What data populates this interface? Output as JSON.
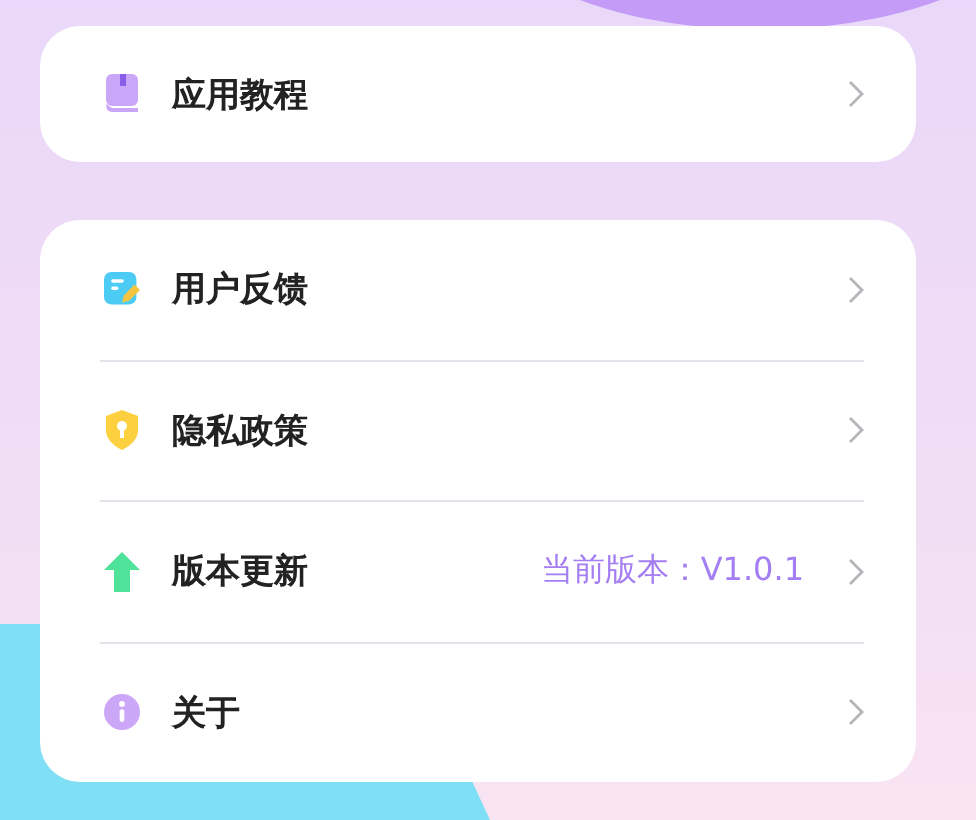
{
  "groups": [
    {
      "items": [
        {
          "kind": "book",
          "label": "应用教程"
        }
      ]
    },
    {
      "items": [
        {
          "kind": "note",
          "label": "用户反馈"
        },
        {
          "kind": "shield",
          "label": "隐私政策"
        },
        {
          "kind": "upload",
          "label": "版本更新",
          "value": "当前版本：V1.0.1"
        },
        {
          "kind": "info",
          "label": "关于"
        }
      ]
    }
  ]
}
